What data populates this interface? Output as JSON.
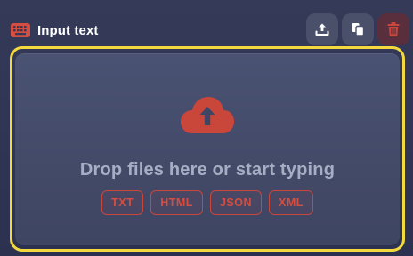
{
  "header": {
    "title": "Input text",
    "title_icon": "keyboard-icon",
    "actions": [
      {
        "name": "upload-button",
        "icon": "upload-icon"
      },
      {
        "name": "copy-button",
        "icon": "copy-icon"
      },
      {
        "name": "delete-button",
        "icon": "trash-icon"
      }
    ]
  },
  "dropzone": {
    "icon": "cloud-upload-icon",
    "message": "Drop files here or start typing",
    "formats": [
      "TXT",
      "HTML",
      "JSON",
      "XML"
    ]
  },
  "colors": {
    "background": "#2f3552",
    "accent_red": "#d44e42",
    "highlight_yellow": "#f3d93e",
    "button_bg": "#4a5069",
    "danger_button_bg": "#5a2f3d"
  }
}
